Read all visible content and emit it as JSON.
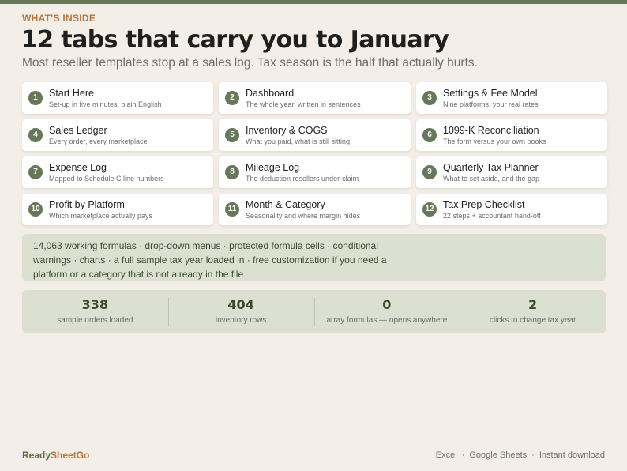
{
  "eyebrow": "WHAT'S INSIDE",
  "title": "12 tabs that carry you to January",
  "subtitle": "Most reseller templates stop at a sales log. Tax season is the half that actually hurts.",
  "tabs": [
    {
      "number": "1",
      "title": "Start Here",
      "subtitle": "Set-up in five minutes, plain English"
    },
    {
      "number": "2",
      "title": "Dashboard",
      "subtitle": "The whole year, written in sentences"
    },
    {
      "number": "3",
      "title": "Settings & Fee Model",
      "subtitle": "Nine platforms, your real rates"
    },
    {
      "number": "4",
      "title": "Sales Ledger",
      "subtitle": "Every order, every marketplace"
    },
    {
      "number": "5",
      "title": "Inventory & COGS",
      "subtitle": "What you paid, what is still sitting"
    },
    {
      "number": "6",
      "title": "1099-K Reconciliation",
      "subtitle": "The form versus your own books"
    },
    {
      "number": "7",
      "title": "Expense Log",
      "subtitle": "Mapped to Schedule C line numbers"
    },
    {
      "number": "8",
      "title": "Mileage Log",
      "subtitle": "The deduction resellers under-claim"
    },
    {
      "number": "9",
      "title": "Quarterly Tax Planner",
      "subtitle": "What to set aside, and the gap"
    },
    {
      "number": "10",
      "title": "Profit by Platform",
      "subtitle": "Which marketplace actually pays"
    },
    {
      "number": "11",
      "title": "Month & Category",
      "subtitle": "Seasonality and where margin hides"
    },
    {
      "number": "12",
      "title": "Tax Prep Checklist",
      "subtitle": "22 steps + accountant hand-off"
    }
  ],
  "features": "14,063 working formulas · drop-down menus · protected formula cells · conditional warnings · charts · a full sample tax year loaded in · free customization if you need a platform or a category that is not already in the file",
  "stats": [
    {
      "value": "338",
      "label": "sample orders loaded"
    },
    {
      "value": "404",
      "label": "inventory rows"
    },
    {
      "value": "0",
      "label": "array formulas — opens anywhere"
    },
    {
      "value": "2",
      "label": "clicks to change tax year"
    }
  ],
  "brand": {
    "part1": "Ready",
    "part2": "SheetGo"
  },
  "footer": {
    "formats": [
      "Excel",
      "Google Sheets",
      "Instant download"
    ],
    "separator": "·"
  },
  "colors": {
    "accent": "#66775a",
    "brand_orange": "#b9743f",
    "panel": "#dbe0d1",
    "background": "#f3efe8"
  }
}
